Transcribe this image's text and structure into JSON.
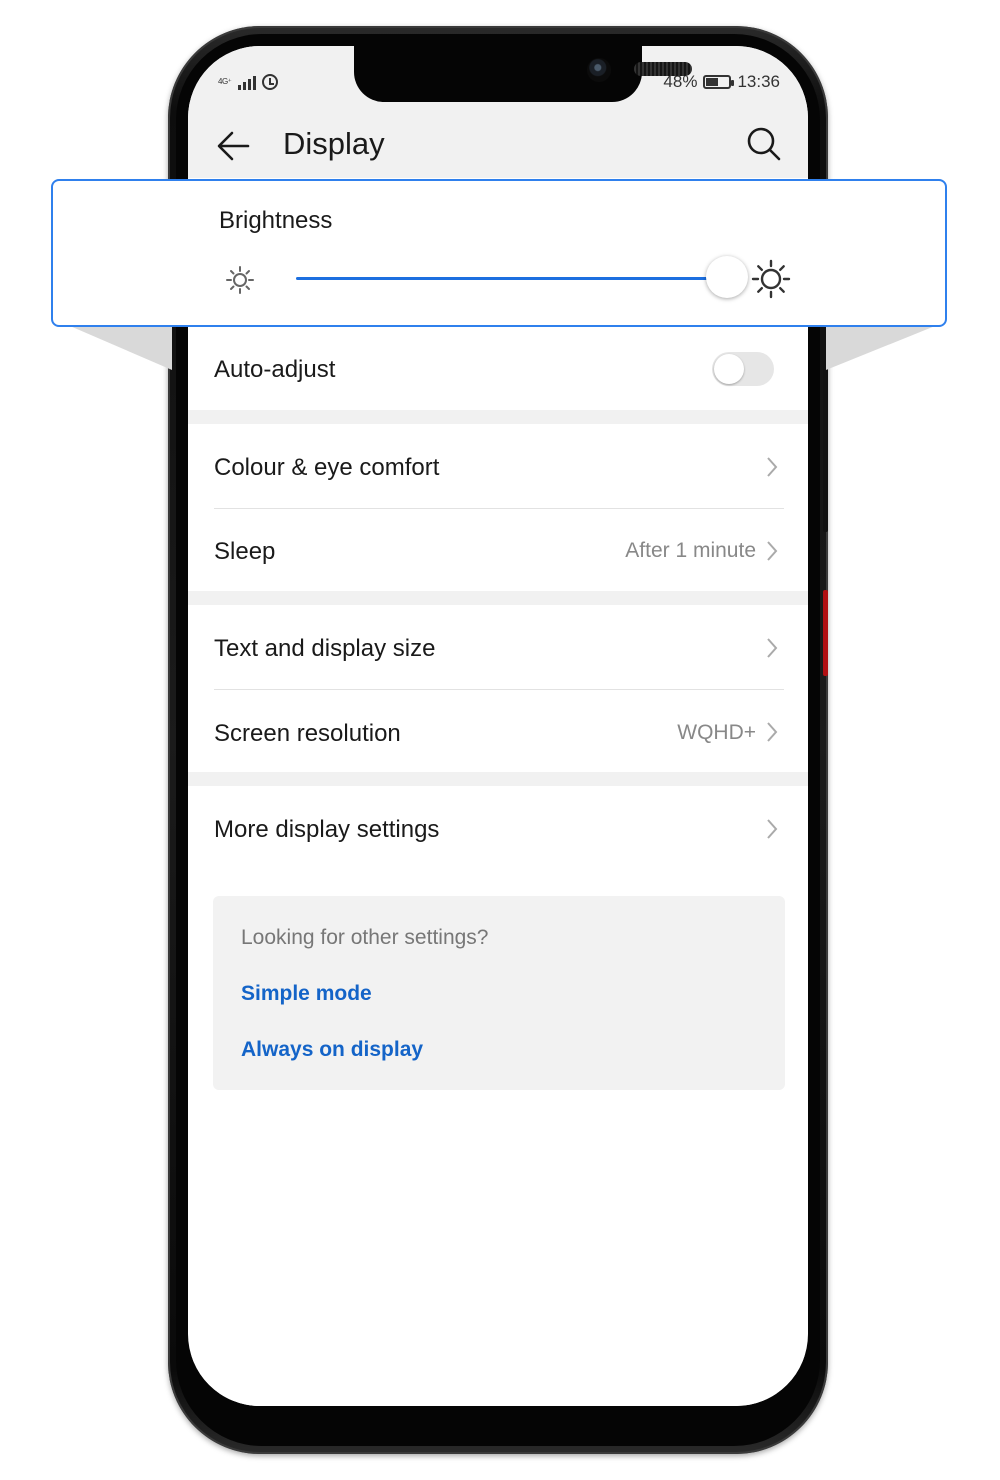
{
  "status_bar": {
    "network": "4G⁺",
    "battery_percent": "48%",
    "battery_level": 0.48,
    "time": "13:36"
  },
  "header": {
    "title": "Display",
    "back_icon": "arrow-left-icon",
    "search_icon": "search-icon"
  },
  "brightness": {
    "label": "Brightness",
    "level": 0.98,
    "low_icon": "sun-small-icon",
    "high_icon": "sun-large-icon",
    "accent": "#1c6fe0",
    "callout_border": "#2f80ed"
  },
  "auto_adjust": {
    "label": "Auto-adjust",
    "enabled": false
  },
  "rows": {
    "colour": {
      "label": "Colour & eye comfort"
    },
    "sleep": {
      "label": "Sleep",
      "value": "After 1 minute"
    },
    "text_size": {
      "label": "Text and display size"
    },
    "resolution": {
      "label": "Screen resolution",
      "value": "WQHD+"
    },
    "more": {
      "label": "More display settings"
    }
  },
  "tips": {
    "title": "Looking for other settings?",
    "links": [
      "Simple mode",
      "Always on display"
    ],
    "link_color": "#1464c8"
  }
}
